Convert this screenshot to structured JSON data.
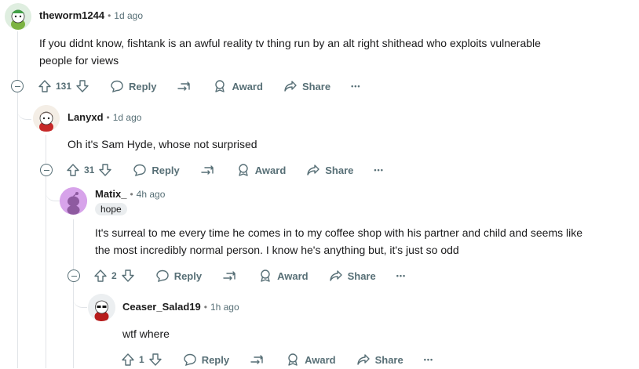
{
  "comments": [
    {
      "author": "theworm1244",
      "time": "1d ago",
      "body": [
        "If you didnt know, fishtank is an awful reality tv thing run by an alt right shithead who exploits vulnerable",
        "people for views"
      ],
      "score": "131"
    },
    {
      "author": "Lanyxd",
      "time": "1d ago",
      "body": [
        "Oh it's Sam Hyde, whose not surprised"
      ],
      "score": "31"
    },
    {
      "author": "Matix_",
      "time": "4h ago",
      "flair": "hope",
      "body": [
        "It's surreal to me every time he comes in to my coffee shop with his partner and child and seems like",
        "the most incredibly normal person. I know he's anything but, it's just so odd"
      ],
      "score": "2"
    },
    {
      "author": "Ceaser_Salad19",
      "time": "1h ago",
      "body": [
        "wtf where"
      ],
      "score": "1"
    }
  ],
  "labels": {
    "reply": "Reply",
    "award": "Award",
    "share": "Share",
    "dot": "•",
    "more": "•••"
  },
  "icons": [
    "upvote-icon",
    "downvote-icon",
    "reply-icon",
    "award-icon",
    "share-icon",
    "more-icon",
    "collapse-icon",
    "separator-icon"
  ]
}
